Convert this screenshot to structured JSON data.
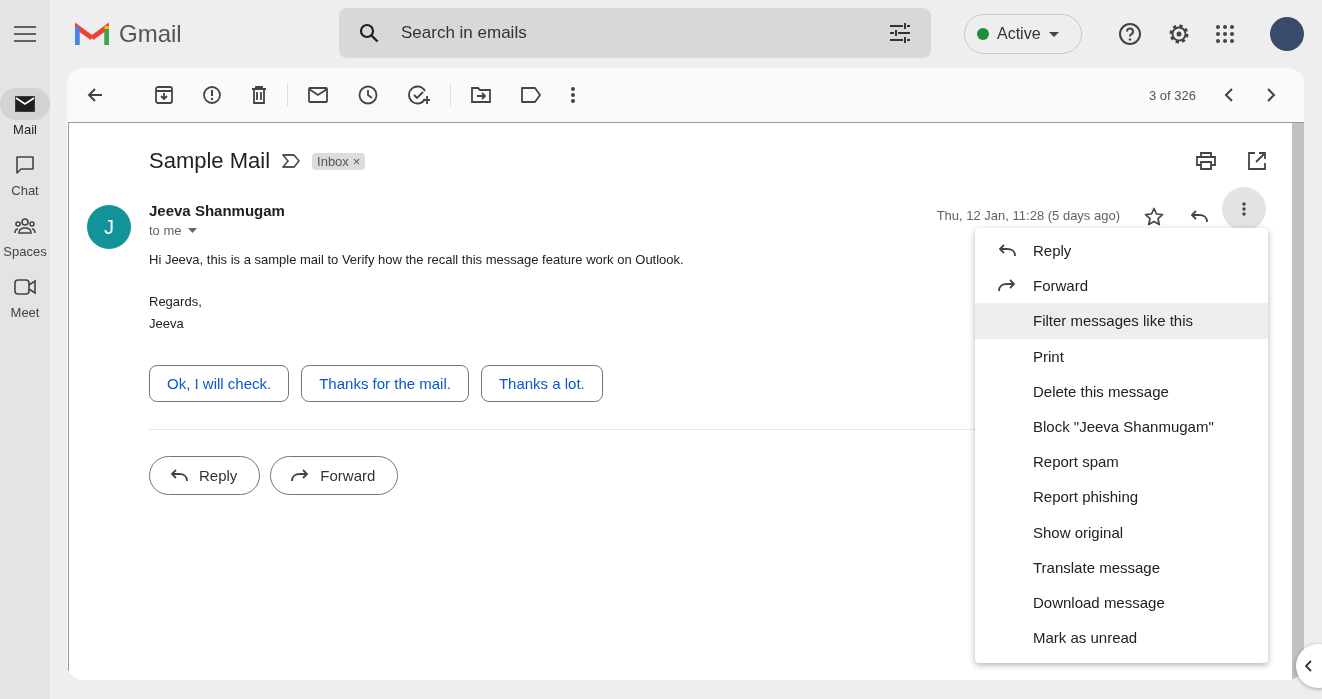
{
  "app": {
    "brand": "Gmail"
  },
  "search": {
    "placeholder": "Search in emails"
  },
  "status": {
    "label": "Active"
  },
  "nav": [
    {
      "label": "Mail",
      "kind": "mail",
      "selected": true
    },
    {
      "label": "Chat",
      "kind": "chat",
      "selected": false
    },
    {
      "label": "Spaces",
      "kind": "spaces",
      "selected": false
    },
    {
      "label": "Meet",
      "kind": "meet",
      "selected": false
    }
  ],
  "toolbar": {
    "counter": "3 of 326"
  },
  "message": {
    "subject": "Sample Mail",
    "label_chip": "Inbox",
    "chip_close": "×",
    "sender_initial": "J",
    "sender": "Jeeva Shanmugam",
    "recipient": "to me",
    "date": "Thu, 12 Jan, 11:28 (5 days ago)",
    "starred": false,
    "body": {
      "paragraph": "Hi Jeeva, this is a sample mail to Verify how the recall this message feature work on Outlook.",
      "signoff": [
        "Regards,",
        "Jeeva"
      ]
    }
  },
  "smart_replies": [
    "Ok, I will check.",
    "Thanks for the mail.",
    "Thanks a lot."
  ],
  "actions": [
    {
      "label": "Reply",
      "kind": "reply"
    },
    {
      "label": "Forward",
      "kind": "forward"
    }
  ],
  "menu": [
    {
      "label": "Reply",
      "kind": "reply",
      "selected": false
    },
    {
      "label": "Forward",
      "kind": "forward",
      "selected": false
    },
    {
      "label": "Filter messages like this",
      "kind": "plain",
      "selected": true
    },
    {
      "label": "Print",
      "kind": "plain",
      "selected": false
    },
    {
      "label": "Delete this message",
      "kind": "plain",
      "selected": false
    },
    {
      "label": "Block \"Jeeva Shanmugam\"",
      "kind": "plain",
      "selected": false
    },
    {
      "label": "Report spam",
      "kind": "plain",
      "selected": false
    },
    {
      "label": "Report phishing",
      "kind": "plain",
      "selected": false
    },
    {
      "label": "Show original",
      "kind": "plain",
      "selected": false
    },
    {
      "label": "Translate message",
      "kind": "plain",
      "selected": false
    },
    {
      "label": "Download message",
      "kind": "plain",
      "selected": false
    },
    {
      "label": "Mark as unread",
      "kind": "plain",
      "selected": false
    }
  ]
}
